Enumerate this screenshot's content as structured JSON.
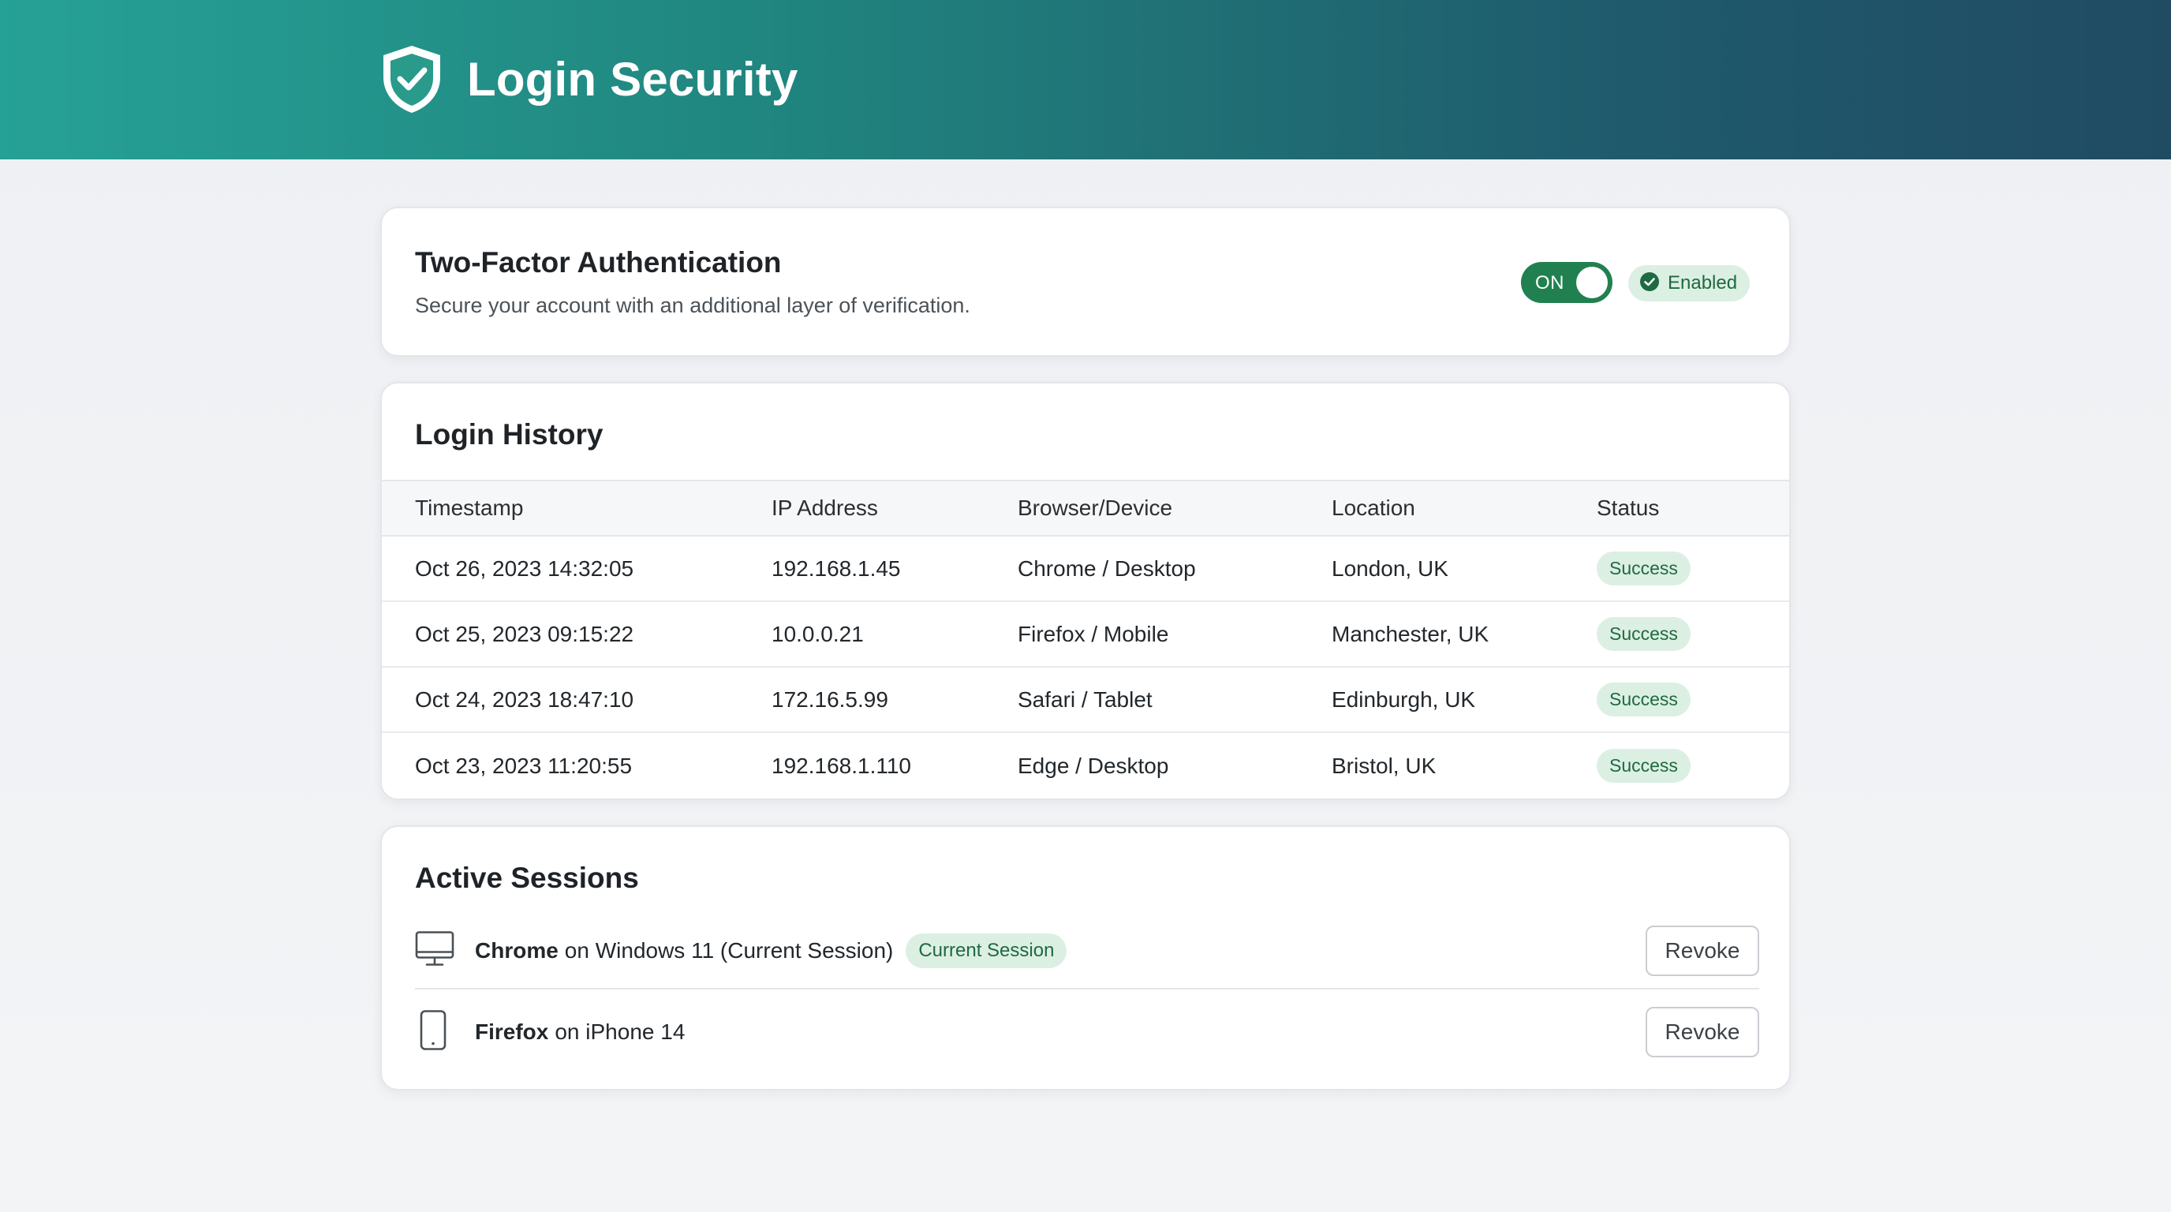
{
  "header": {
    "title": "Login Security",
    "icon": "shield-check-icon",
    "colors": {
      "gradient_start": "#26a196",
      "gradient_end": "#204b63"
    }
  },
  "two_factor": {
    "title": "Two-Factor Authentication",
    "description": "Secure your account with an additional layer of verification.",
    "toggle_label": "ON",
    "toggle_on": true,
    "status_label": "Enabled",
    "accent_color": "#21804f"
  },
  "login_history": {
    "title": "Login History",
    "columns": [
      "Timestamp",
      "IP Address",
      "Browser/Device",
      "Location",
      "Status"
    ],
    "rows": [
      {
        "timestamp": "Oct 26, 2023 14:32:05",
        "ip": "192.168.1.45",
        "device": "Chrome / Desktop",
        "location": "London, UK",
        "status": "Success"
      },
      {
        "timestamp": "Oct 25, 2023 09:15:22",
        "ip": "10.0.0.21",
        "device": "Firefox / Mobile",
        "location": "Manchester, UK",
        "status": "Success"
      },
      {
        "timestamp": "Oct 24, 2023 18:47:10",
        "ip": "172.16.5.99",
        "device": "Safari / Tablet",
        "location": "Edinburgh, UK",
        "status": "Success"
      },
      {
        "timestamp": "Oct 23, 2023 11:20:55",
        "ip": "192.168.1.110",
        "device": "Edge / Desktop",
        "location": "Bristol, UK",
        "status": "Success"
      }
    ]
  },
  "active_sessions": {
    "title": "Active Sessions",
    "sessions": [
      {
        "browser": "Chrome",
        "rest": "on Windows 11 (Current Session)",
        "badge": "Current Session",
        "icon": "desktop-monitor-icon",
        "action": "Revoke"
      },
      {
        "browser": "Firefox",
        "rest": "on iPhone 14",
        "icon": "mobile-phone-icon",
        "action": "Revoke"
      }
    ]
  }
}
